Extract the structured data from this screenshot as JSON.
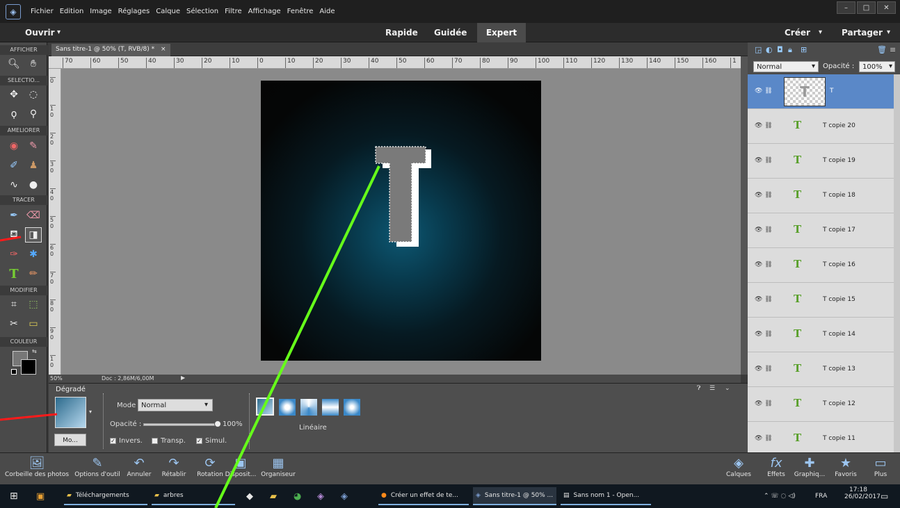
{
  "menu": {
    "items": [
      "Fichier",
      "Edition",
      "Image",
      "Réglages",
      "Calque",
      "Sélection",
      "Filtre",
      "Affichage",
      "Fenêtre",
      "Aide"
    ],
    "window_controls": [
      "–",
      "□",
      "✕"
    ]
  },
  "modebar": {
    "open_label": "Ouvrir",
    "modes": [
      "Rapide",
      "Guidée",
      "Expert"
    ],
    "create_label": "Créer",
    "share_label": "Partager"
  },
  "toolbox": {
    "sections": [
      "AFFICHER",
      "SELECTIO...",
      "AMELIORER",
      "TRACER",
      "MODIFIER",
      "COULEUR"
    ]
  },
  "document": {
    "tab_title": "Sans titre-1 @ 50% (T, RVB/8) *",
    "tab_close": "×",
    "zoom": "50%",
    "doc_info": "Doc : 2,86M/6,00M",
    "ruler_h_labels": [
      "70",
      "60",
      "50",
      "40",
      "30",
      "20",
      "10",
      "0",
      "10",
      "20",
      "30",
      "40",
      "50",
      "60",
      "70",
      "80",
      "90",
      "100",
      "110",
      "120",
      "130",
      "140",
      "150",
      "160",
      "1"
    ],
    "ruler_v_labels": [
      "0",
      "1 0",
      "2 0",
      "3 0",
      "4 0",
      "5 0",
      "6 0",
      "7 0",
      "8 0",
      "9 0",
      "1 0"
    ]
  },
  "options": {
    "tool_name": "Dégradé",
    "mode_label": "Mode :",
    "mode_value": "Normal",
    "opacity_label": "Opacité :",
    "opacity_value": "100%",
    "opacity_level": 1.0,
    "more_button": "Mo...",
    "inverse_label": "Invers.",
    "inverse_checked": true,
    "transparent_label": "Transp.",
    "transparent_checked": false,
    "simulate_label": "Simul.",
    "simulate_checked": true,
    "gradient_type": "Linéaire"
  },
  "layers": {
    "blend_mode": "Normal",
    "opacity_label": "Opacité :",
    "opacity_value": "100%",
    "items": [
      {
        "name": "T",
        "selected": true
      },
      {
        "name": "T copie 20"
      },
      {
        "name": "T copie 19"
      },
      {
        "name": "T copie 18"
      },
      {
        "name": "T copie 17"
      },
      {
        "name": "T copie 16"
      },
      {
        "name": "T copie 15"
      },
      {
        "name": "T copie 14"
      },
      {
        "name": "T copie 13"
      },
      {
        "name": "T copie 12"
      },
      {
        "name": "T copie 11"
      }
    ]
  },
  "bottom_tools": {
    "left": [
      "Corbeille des photos",
      "Options d'outil",
      "Annuler",
      "Rétablir",
      "Rotation",
      "Disposit...",
      "Organiseur"
    ],
    "right": [
      "Calques",
      "Effets",
      "Graphiq...",
      "Favoris",
      "Plus"
    ]
  },
  "taskbar": {
    "items": [
      "Téléchargements",
      "arbres",
      "Créer un effet de te...",
      "Sans titre-1 @ 50% ...",
      "Sans nom 1 - Open..."
    ],
    "language": "FRA",
    "time": "17:18",
    "date": "26/02/2017"
  },
  "colors": {
    "accent": "#5a88c8",
    "annotation_red": "#ff1a1a",
    "annotation_green": "#66ff1a",
    "layer_text_icon": "#5aa02c"
  }
}
